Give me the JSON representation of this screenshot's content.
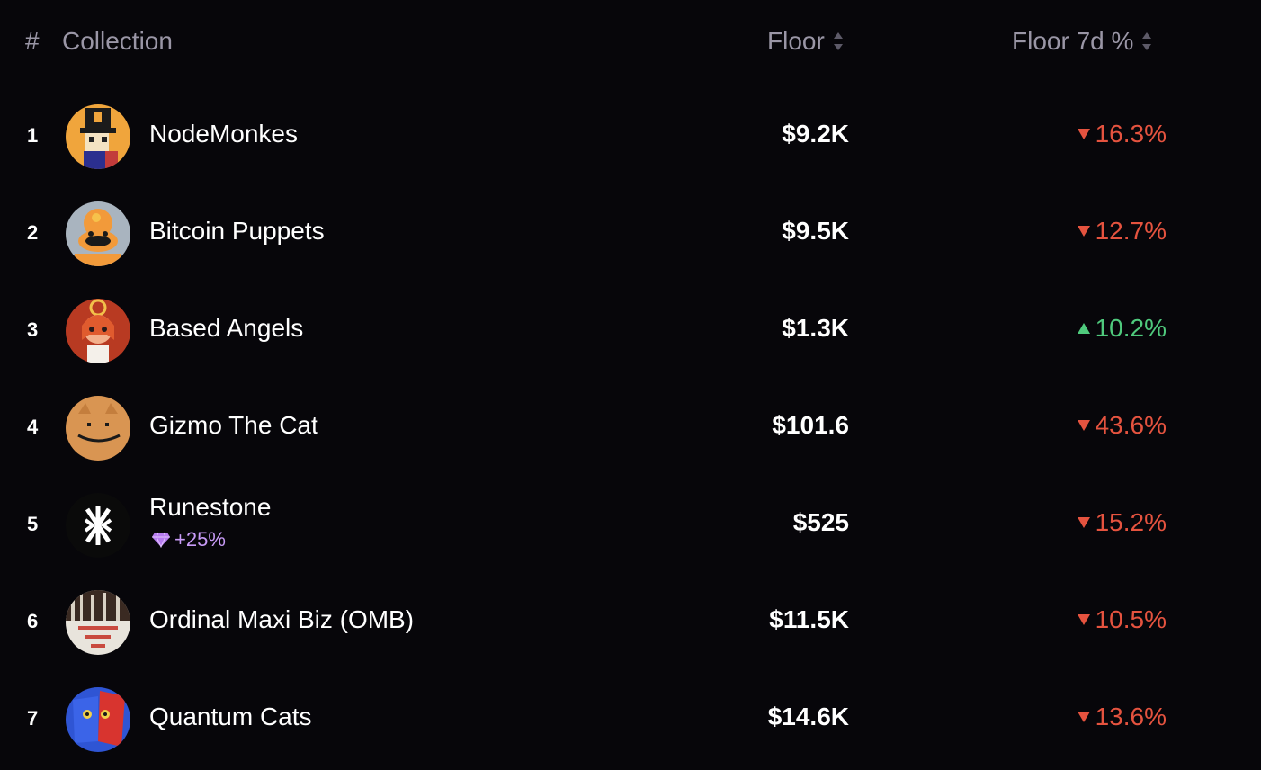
{
  "header": {
    "num": "#",
    "collection": "Collection",
    "floor": "Floor",
    "floor_7d": "Floor 7d %"
  },
  "colors": {
    "background": "#07060a",
    "header_text": "#9a96a6",
    "negative": "#e5533f",
    "positive": "#4fca7d",
    "badge": "#c89bf7"
  },
  "rows": [
    {
      "rank": "1",
      "name": "NodeMonkes",
      "floor": "$9.2K",
      "change": "16.3%",
      "direction": "down",
      "avatar": "monkey-pixel-avatar"
    },
    {
      "rank": "2",
      "name": "Bitcoin Puppets",
      "floor": "$9.5K",
      "change": "12.7%",
      "direction": "down",
      "avatar": "puppet-avatar"
    },
    {
      "rank": "3",
      "name": "Based Angels",
      "floor": "$1.3K",
      "change": "10.2%",
      "direction": "up",
      "avatar": "angel-avatar"
    },
    {
      "rank": "4",
      "name": "Gizmo The Cat",
      "floor": "$101.6",
      "change": "43.6%",
      "direction": "down",
      "avatar": "cat-face-avatar"
    },
    {
      "rank": "5",
      "name": "Runestone",
      "sub": "+25%",
      "sub_icon": "diamond-icon",
      "floor": "$525",
      "change": "15.2%",
      "direction": "down",
      "avatar": "rune-avatar"
    },
    {
      "rank": "6",
      "name": "Ordinal Maxi Biz (OMB)",
      "floor": "$11.5K",
      "change": "10.5%",
      "direction": "down",
      "avatar": "omb-avatar"
    },
    {
      "rank": "7",
      "name": "Quantum Cats",
      "floor": "$14.6K",
      "change": "13.6%",
      "direction": "down",
      "avatar": "quantum-cat-avatar"
    }
  ]
}
